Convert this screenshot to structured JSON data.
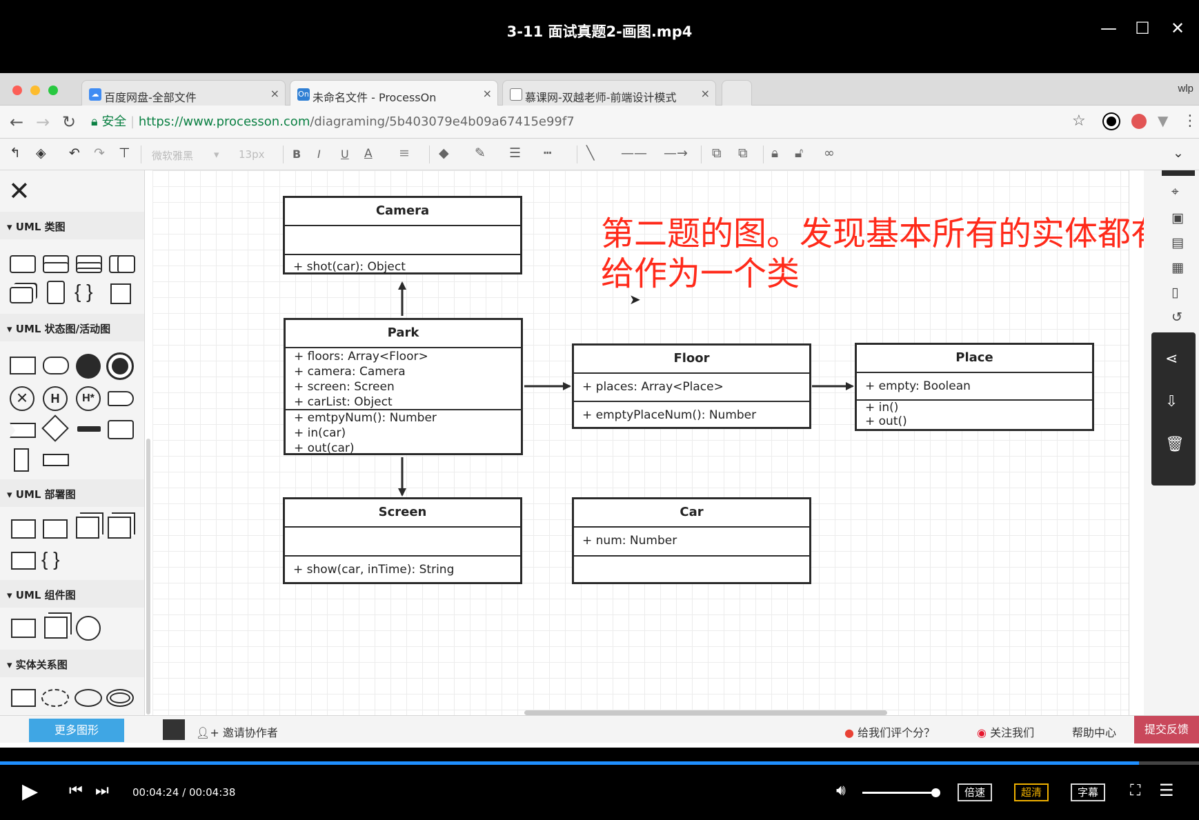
{
  "player": {
    "title": "3-11 面试真题2-画图.mp4",
    "current_time": "00:04:24",
    "separator": "/",
    "total_time": "00:04:38",
    "progress": 0.95,
    "speed_label": "倍速",
    "quality_label": "超清",
    "subtitle_label": "字幕",
    "accent_color": "#1f8fff",
    "quality_color": "#f0b100"
  },
  "browser": {
    "tabs": [
      {
        "label": "百度网盘-全部文件",
        "icon": "baidu-cloud-icon"
      },
      {
        "label": "未命名文件 - ProcessOn",
        "icon": "processon-icon",
        "icon_text": "On"
      },
      {
        "label": "慕课网-双越老师-前端设计模式",
        "icon": "page-icon"
      }
    ],
    "user": "wlp",
    "secure_label": "安全",
    "url_host": "https://www.processon.com",
    "url_path": "/diagraming/5b403079e4b09a67415e99f7"
  },
  "toolbar": {
    "font_family": "微软雅黑",
    "font_size": "13px"
  },
  "sidebar": {
    "sections": [
      "UML 类图",
      "UML 状态图/活动图",
      "UML 部署图",
      "UML 组件图",
      "实体关系图"
    ],
    "more_shapes": "更多图形"
  },
  "diagram": {
    "classes": [
      {
        "id": "camera",
        "name": "Camera",
        "attributes": [],
        "methods": [
          "+ shot(car): Object"
        ]
      },
      {
        "id": "park",
        "name": "Park",
        "attributes": [
          "+ floors: Array<Floor>",
          "+ camera: Camera",
          "+ screen: Screen",
          "+ carList: Object"
        ],
        "methods": [
          "+ emtpyNum(): Number",
          "+ in(car)",
          "+ out(car)"
        ]
      },
      {
        "id": "floor",
        "name": "Floor",
        "attributes": [
          "+ places: Array<Place>"
        ],
        "methods": [
          "+ emptyPlaceNum(): Number"
        ]
      },
      {
        "id": "place",
        "name": "Place",
        "attributes": [
          "+ empty: Boolean"
        ],
        "methods": [
          "+ in()",
          "+ out()"
        ]
      },
      {
        "id": "screen",
        "name": "Screen",
        "attributes": [],
        "methods": [
          "+ show(car, inTime): String"
        ]
      },
      {
        "id": "car",
        "name": "Car",
        "attributes": [
          "+ num: Number"
        ],
        "methods": []
      }
    ],
    "annotation_line1": "第二题的图。发现基本所有的实体都有",
    "annotation_line2": "给作为一个类",
    "annotation_color": "#ff2a1a"
  },
  "statusbar": {
    "invite": "邀请协作者",
    "rate": "给我们评个分？",
    "follow": "关注我们",
    "help": "帮助中心",
    "feedback": "提交反馈"
  }
}
